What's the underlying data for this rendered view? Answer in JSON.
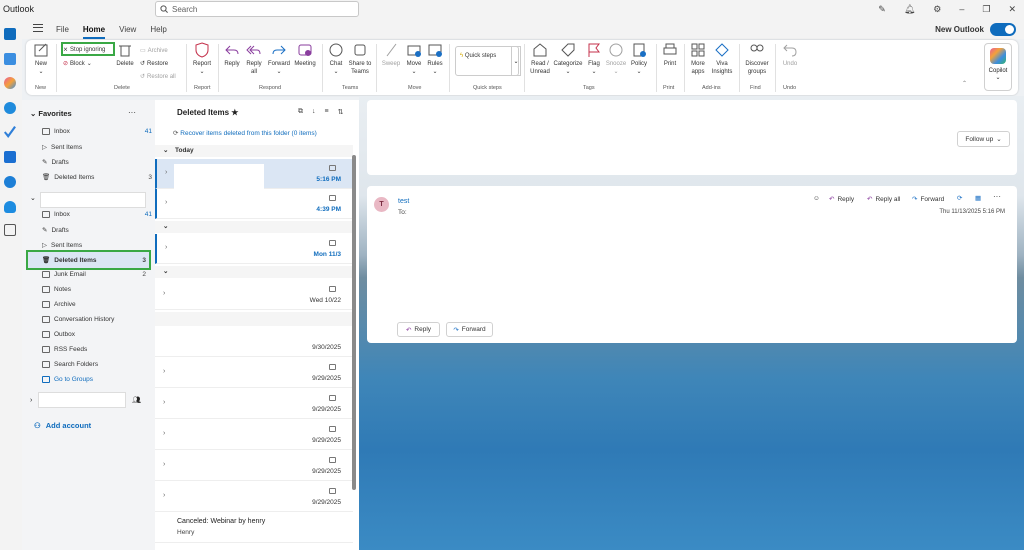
{
  "app": {
    "title": "Outlook",
    "search_placeholder": "Search",
    "new_outlook_label": "New Outlook"
  },
  "menu": {
    "tabs": [
      "File",
      "Home",
      "View",
      "Help"
    ]
  },
  "ribbon": {
    "new": "New",
    "new_group": "New",
    "stop_ignoring": "Stop ignoring",
    "block": "Block",
    "delete": "Delete",
    "archive": "Archive",
    "restore": "Restore",
    "restore_all": "Restore all",
    "delete_group": "Delete",
    "report": "Report",
    "report_group": "Report",
    "reply": "Reply",
    "reply_all_1": "Reply",
    "reply_all_2": "all",
    "forward": "Forward",
    "meeting": "Meeting",
    "respond_group": "Respond",
    "chat": "Chat",
    "share_1": "Share to",
    "share_2": "Teams",
    "teams_group": "Teams",
    "sweep": "Sweep",
    "move": "Move",
    "rules": "Rules",
    "move_group": "Move",
    "quick_steps": "Quick steps",
    "quick_steps_group": "Quick steps",
    "read_1": "Read /",
    "read_2": "Unread",
    "categorize": "Categorize",
    "flag": "Flag",
    "snooze": "Snooze",
    "policy": "Policy",
    "tags_group": "Tags",
    "print": "Print",
    "print_group": "Print",
    "more_apps_1": "More",
    "more_apps_2": "apps",
    "viva_1": "Viva",
    "viva_2": "Insights",
    "addins_group": "Add-ins",
    "discover_1": "Discover",
    "discover_2": "groups",
    "find_group": "Find",
    "undo": "Undo",
    "undo_group": "Undo",
    "copilot": "Copilot"
  },
  "folders": {
    "favorites": "Favorites",
    "fav_items": [
      {
        "label": "Inbox",
        "count": "41"
      },
      {
        "label": "Sent Items",
        "count": ""
      },
      {
        "label": "Drafts",
        "count": ""
      },
      {
        "label": "Deleted Items",
        "count": "3"
      }
    ],
    "account_items": [
      {
        "label": "Inbox",
        "count": "41"
      },
      {
        "label": "Drafts",
        "count": ""
      },
      {
        "label": "Sent Items",
        "count": ""
      },
      {
        "label": "Deleted Items",
        "count": "3"
      },
      {
        "label": "Junk Email",
        "count": "2"
      },
      {
        "label": "Notes",
        "count": ""
      },
      {
        "label": "Archive",
        "count": ""
      },
      {
        "label": "Conversation History",
        "count": ""
      },
      {
        "label": "Outbox",
        "count": ""
      },
      {
        "label": "RSS Feeds",
        "count": ""
      },
      {
        "label": "Search Folders",
        "count": ""
      },
      {
        "label": "Go to Groups",
        "count": ""
      }
    ],
    "add_account": "Add account"
  },
  "list": {
    "title": "Deleted Items",
    "recover": "Recover items deleted from this folder (0 items)",
    "section_today": "Today",
    "rows": [
      {
        "date": "5:16 PM"
      },
      {
        "date": "4:39 PM"
      },
      {
        "date": "Mon 11/3"
      },
      {
        "date": "Wed 10/22"
      },
      {
        "date": "9/30/2025"
      },
      {
        "date": "9/29/2025"
      },
      {
        "date": "9/29/2025"
      },
      {
        "date": "9/29/2025"
      },
      {
        "date": "9/29/2025"
      },
      {
        "date": "9/29/2025"
      }
    ],
    "last_subject": "Canceled: Webinar by henry",
    "last_sender": "Henry"
  },
  "reading": {
    "follow_up": "Follow up",
    "sender": "test",
    "avatar": "T",
    "to": "To:",
    "timestamp": "Thu 11/13/2025 5:16 PM",
    "reply": "Reply",
    "reply_all": "Reply all",
    "forward": "Forward"
  }
}
